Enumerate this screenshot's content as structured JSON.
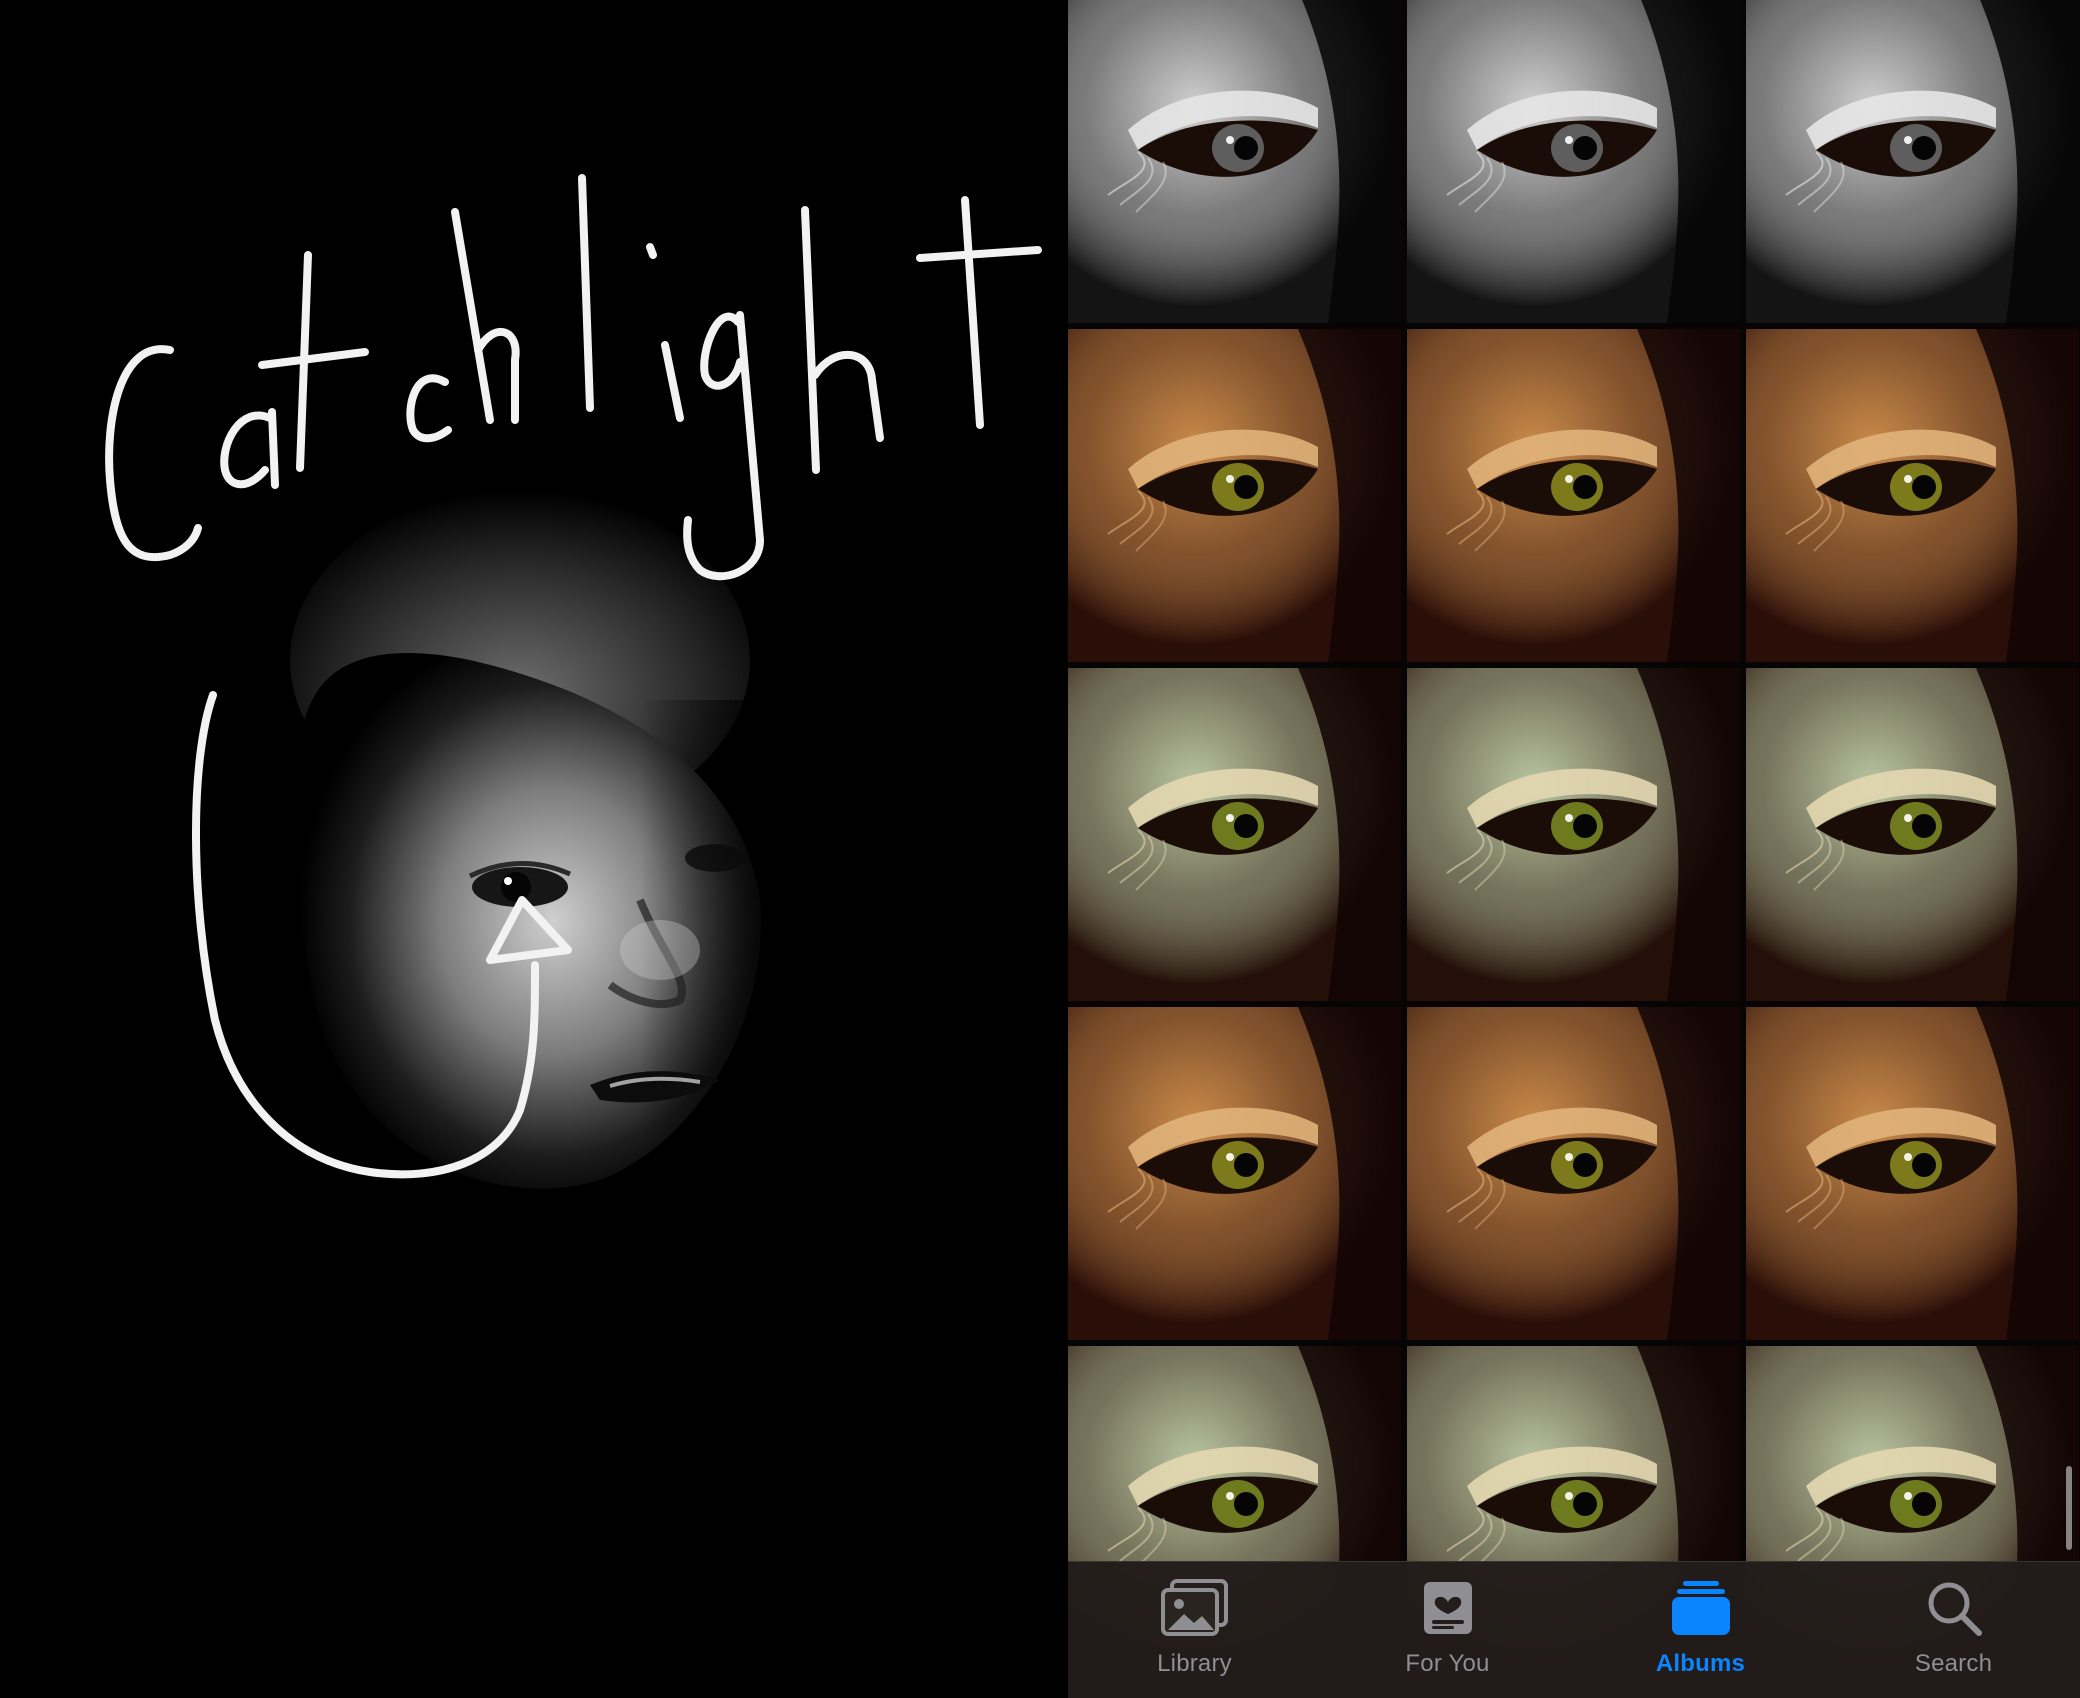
{
  "annotation": {
    "handwritten_text": "Catchlight",
    "stroke_color": "#f2f2f2"
  },
  "photo_grid": {
    "rows": [
      {
        "style": "bw",
        "tone": "#b8b8b8",
        "count": 3
      },
      {
        "style": "warm-amber",
        "tone": "#c98a4a",
        "count": 3
      },
      {
        "style": "green-tint",
        "tone": "#b9c4a0",
        "count": 3
      },
      {
        "style": "warm-amber",
        "tone": "#c98a4a",
        "count": 3
      },
      {
        "style": "green-tint",
        "tone": "#b9c4a0",
        "count": 3
      }
    ]
  },
  "tab_bar": {
    "active_color": "#0a84ff",
    "inactive_color": "#8e8e93",
    "tabs": [
      {
        "label": "Library",
        "icon": "photos-stack-icon",
        "active": false
      },
      {
        "label": "For You",
        "icon": "for-you-heart-card-icon",
        "active": false
      },
      {
        "label": "Albums",
        "icon": "albums-folder-icon",
        "active": true
      },
      {
        "label": "Search",
        "icon": "magnifier-search-icon",
        "active": false
      }
    ]
  }
}
